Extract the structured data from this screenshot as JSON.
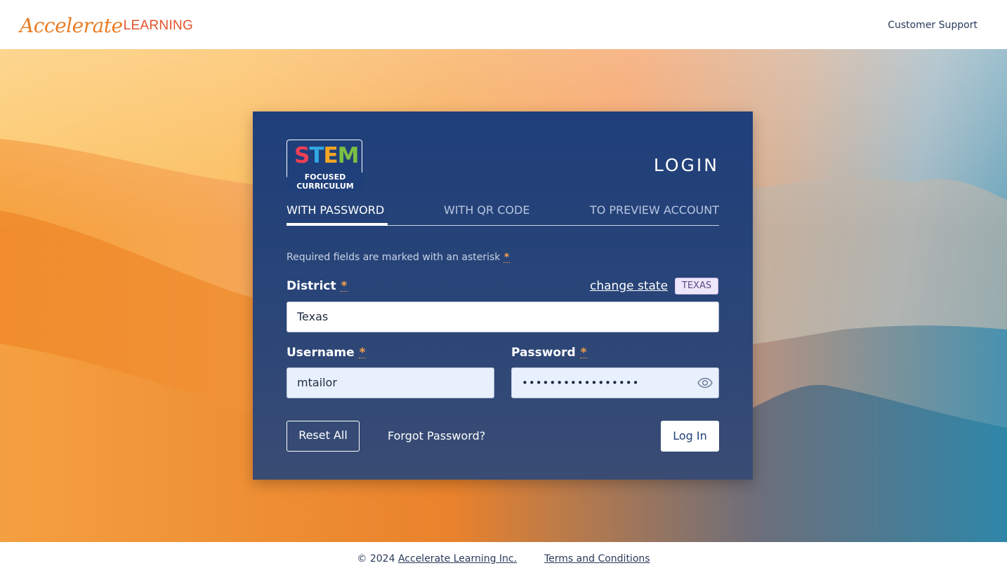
{
  "header": {
    "logo_script": "Accelerate",
    "logo_caps": "LEARNING",
    "support_label": "Customer Support"
  },
  "card": {
    "brand": {
      "letters": [
        "S",
        "T",
        "E",
        "M"
      ],
      "sub_line1": "FOCUSED",
      "sub_line2": "CURRICULUM"
    },
    "title": "LOGIN",
    "tabs": [
      {
        "label": "WITH PASSWORD",
        "active": true
      },
      {
        "label": "WITH QR CODE",
        "active": false
      },
      {
        "label": "TO PREVIEW ACCOUNT",
        "active": false
      }
    ],
    "required_note": "Required fields are marked with an asterisk",
    "asterisk": "*",
    "district": {
      "label": "District",
      "value": "Texas",
      "change_state_label": "change state",
      "state_badge": "TEXAS"
    },
    "username": {
      "label": "Username",
      "value": "mtailor"
    },
    "password": {
      "label": "Password",
      "value_masked": "•••••••••••••••••"
    },
    "buttons": {
      "reset": "Reset All",
      "forgot": "Forgot Password?",
      "login": "Log In"
    }
  },
  "footer": {
    "copyright": "© 2024",
    "company_link": "Accelerate Learning Inc.",
    "terms_link": "Terms and Conditions"
  },
  "colors": {
    "card_bg": "#1f3f7a",
    "accent_orange": "#f6a04a",
    "logo_orange": "#e97c25",
    "logo_red": "#e2522a"
  }
}
